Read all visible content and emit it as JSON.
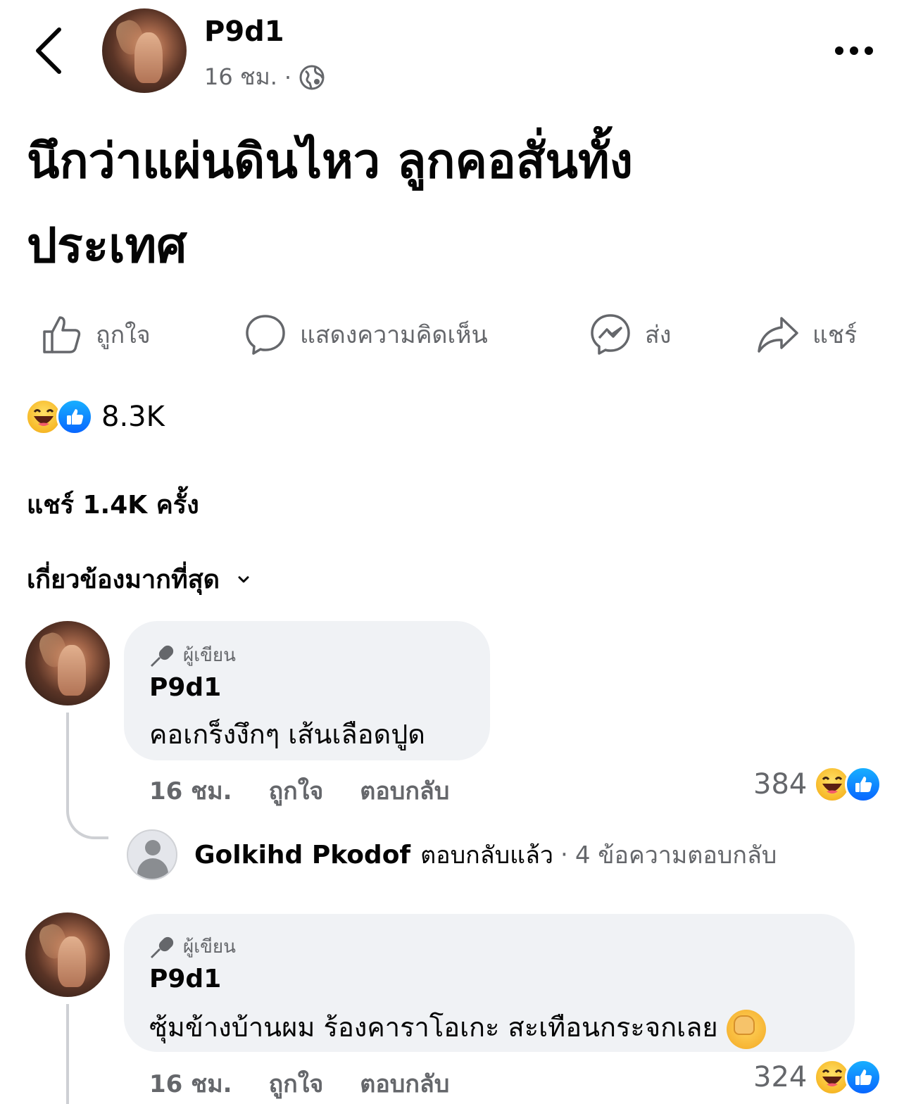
{
  "header": {
    "author": "P9d1",
    "time": "16 ชม.",
    "separator": "·",
    "audience_icon": "globe-icon"
  },
  "post": {
    "text_line1": "นึกว่าแผ่นดินไหว ลูกคอสั่นทั้ง",
    "text_line2": "ประเทศ"
  },
  "actions": {
    "like": "ถูกใจ",
    "comment": "แสดงความคิดเห็น",
    "send": "ส่ง",
    "share": "แชร์"
  },
  "reactions": {
    "count": "8.3K",
    "icons": [
      "haha-emoji",
      "like-emoji"
    ]
  },
  "shares": "แชร์ 1.4K ครั้ง",
  "sort_label": "เกี่ยวข้องมากที่สุด",
  "comments": [
    {
      "badge": "ผู้เขียน",
      "name": "P9d1",
      "text": "คอเกร็งงึกๆ เส้นเลือดปูด",
      "time": "16 ชม.",
      "like": "ถูกใจ",
      "reply": "ตอบกลับ",
      "reaction_count": "384"
    },
    {
      "badge": "ผู้เขียน",
      "name": "P9d1",
      "text": "ซุ้มข้างบ้านผม ร้องคาราโอเกะ สะเทือนกระจกเลย",
      "time": "16 ชม.",
      "like": "ถูกใจ",
      "reply": "ตอบกลับ",
      "reaction_count": "324"
    }
  ],
  "reply_summary": {
    "name": "Golkihd Pkodof",
    "action": "ตอบกลับแล้ว",
    "separator": "·",
    "count": "4 ข้อความตอบกลับ"
  },
  "colors": {
    "secondary_text": "#65676b",
    "bubble": "#f0f2f5",
    "like_blue": "#0866ff",
    "haha_yellow": "#f7b928"
  }
}
